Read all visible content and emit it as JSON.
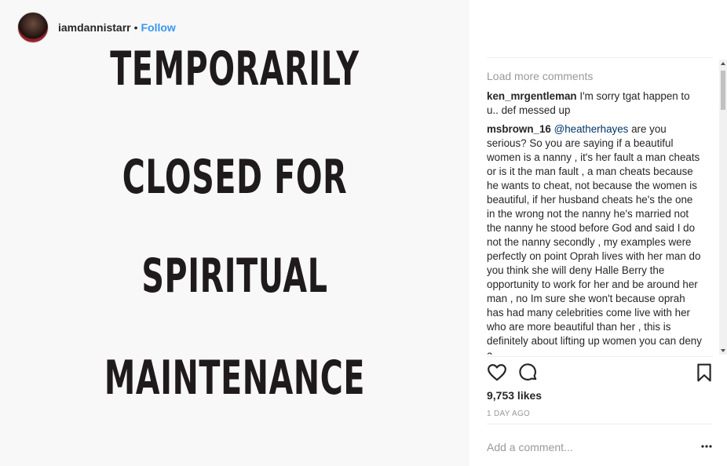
{
  "post_image": {
    "lines": [
      "TEMPORARILY",
      "CLOSED FOR",
      "SPIRITUAL",
      "MAINTENANCE"
    ]
  },
  "header": {
    "username": "iamdannistarr",
    "separator": "•",
    "follow_label": "Follow"
  },
  "comments": {
    "load_more": "Load more comments",
    "items": [
      {
        "username": "ken_mrgentleman",
        "text": "I'm sorry tgat happen to u.. def messed up"
      },
      {
        "username": "msbrown_16",
        "mention": "@heatherhayes",
        "text": "are you serious? So you are saying if a beautiful women is a nanny , it's her fault a man cheats or is it the man fault , a man cheats because he wants to cheat, not because the women is beautiful, if her husband cheats he's the one in the wrong not the nanny he's married not the nanny he stood before God and said I do not the nanny secondly , my examples were perfectly on point Oprah lives with her man do you think she will deny Halle Berry the opportunity to work for her and be around her man , no Im sure she won't because oprah has had many celebrities come live with her who are more beautiful than her , this is definitely about lifting up women you can deny a"
      }
    ]
  },
  "actions": {
    "like_icon": "heart-icon",
    "comment_icon": "comment-bubble-icon",
    "save_icon": "bookmark-icon"
  },
  "likes": "9,753 likes",
  "timestamp": "1 DAY AGO",
  "add_comment": {
    "placeholder": "Add a comment...",
    "more_icon": "more-options-icon"
  },
  "colors": {
    "accent": "#3897f0",
    "mention": "#003569",
    "muted": "#999999",
    "text": "#262626"
  }
}
